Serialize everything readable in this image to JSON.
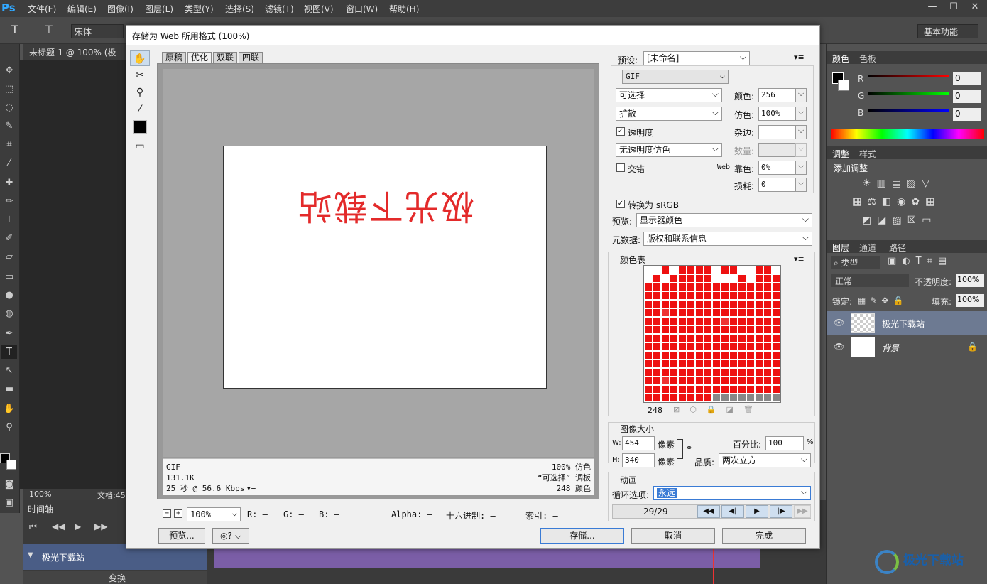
{
  "app": {
    "logo": "Ps",
    "menu": [
      "文件(F)",
      "编辑(E)",
      "图像(I)",
      "图层(L)",
      "类型(Y)",
      "选择(S)",
      "滤镜(T)",
      "视图(V)",
      "窗口(W)",
      "帮助(H)"
    ],
    "font_name": "宋体",
    "workspace": "基本功能",
    "doc_tab": "未标题-1 @ 100% (极光",
    "doc_zoom": "100%",
    "doc_info": "文档:45",
    "timeline_label": "时间轴",
    "layer_track_name": "极光下载站",
    "transform_label": "变换"
  },
  "panels": {
    "color_tabs": [
      "颜色",
      "色板"
    ],
    "rgb": {
      "r_label": "R",
      "g_label": "G",
      "b_label": "B",
      "r": "0",
      "g": "0",
      "b": "0"
    },
    "adjust_tabs": [
      "调整",
      "样式"
    ],
    "add_adjust": "添加调整",
    "layer_tabs": [
      "图层",
      "通道",
      "路径"
    ],
    "kind": "类型",
    "blend": "正常",
    "opacity_label": "不透明度:",
    "opacity": "100%",
    "lock_label": "锁定:",
    "fill_label": "填充:",
    "fill": "100%",
    "layers": [
      {
        "name": "极光下载站"
      },
      {
        "name": "背景"
      }
    ]
  },
  "dialog": {
    "title": "存储为 Web 所用格式 (100%)",
    "tabs": [
      "原稿",
      "优化",
      "双联",
      "四联"
    ],
    "preview_text": "极光下载站",
    "status_left": [
      "GIF",
      "131.1K",
      "25 秒 @ 56.6 Kbps"
    ],
    "status_right": [
      "100% 仿色",
      "“可选择” 调板",
      "248 颜色"
    ],
    "zoom": "100%",
    "readouts": {
      "r": "R: —",
      "g": "G: —",
      "b": "B: —",
      "alpha": "Alpha: —",
      "hex": "十六进制: —",
      "index": "索引: —"
    },
    "preview_btn": "预览...",
    "save_btn": "存储...",
    "cancel_btn": "取消",
    "done_btn": "完成",
    "preset_label": "预设:",
    "preset_value": "[未命名]",
    "format": "GIF",
    "reduction": "可选择",
    "dither_algo": "扩散",
    "transparency_label": "透明度",
    "matte_dither": "无透明度仿色",
    "interlaced_label": "交错",
    "colors_label": "颜色:",
    "colors_value": "256",
    "dither_label": "仿色:",
    "dither_value": "100%",
    "matte_label": "杂边:",
    "amount_label": "数量:",
    "websnap_label_a": "Web",
    "websnap_label_b": "靠色:",
    "websnap_value": "0%",
    "lossy_label": "损耗:",
    "lossy_value": "0",
    "convert_srgb": "转换为 sRGB",
    "preview_label": "预览:",
    "preview_value": "显示器颜色",
    "metadata_label": "元数据:",
    "metadata_value": "版权和联系信息",
    "color_table_label": "颜色表",
    "color_count": "248",
    "image_size_label": "图像大小",
    "w_label": "W:",
    "w_value": "454",
    "h_label": "H:",
    "h_value": "340",
    "px_unit": "像素",
    "percent_label": "百分比:",
    "percent_value": "100",
    "pct_sign": "%",
    "quality_label": "品质:",
    "quality_value": "两次立方",
    "animation_label": "动画",
    "loop_label": "循环选项:",
    "loop_value": "永远",
    "frame_counter": "29/29"
  },
  "watermark": "极光下载站",
  "colors": {
    "accent": "#3a7bd5",
    "preview_text": "#e32a2a",
    "timeline_purple": "#7b5ea7"
  }
}
